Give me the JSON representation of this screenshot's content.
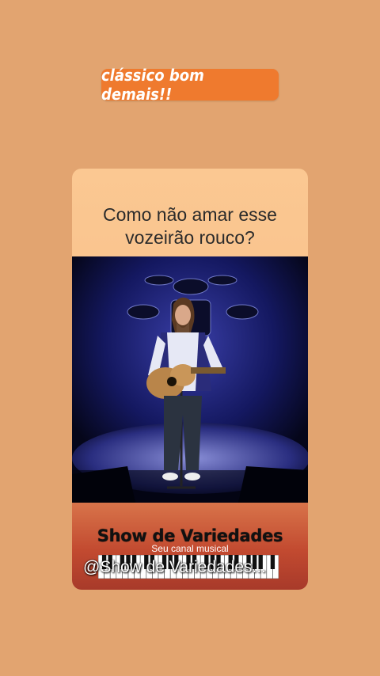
{
  "tagline": "clássico bom demais!!",
  "card": {
    "question_line1": "Como não amar esse",
    "question_line2": "vozeirão rouco?"
  },
  "video": {
    "description_icon": "concert-performer-image"
  },
  "footer": {
    "channel_name": "Show de Variedades",
    "channel_subtitle": "Seu canal musical",
    "handle": "@Show de Variedades..."
  },
  "colors": {
    "background": "#e2a470",
    "tagline_bg": "#ef7a2e",
    "card_bg": "#fbc892",
    "footer_red": "#c24a30"
  }
}
